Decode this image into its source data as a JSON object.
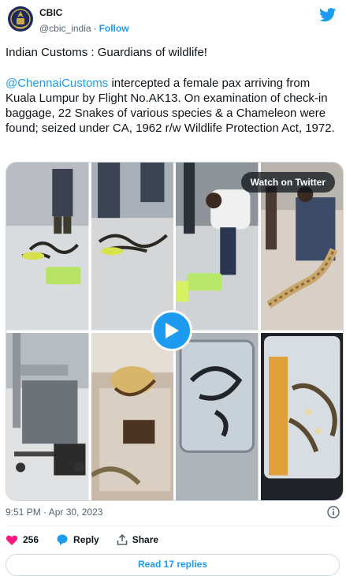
{
  "account": {
    "name": "CBIC",
    "handle": "@cbic_india",
    "separator": "·",
    "follow_label": "Follow"
  },
  "tweet": {
    "line1": "Indian Customs : Guardians of wildlife!",
    "mention": "@ChennaiCustoms",
    "body": " intercepted a female pax arriving from Kuala Lumpur by Flight No.AK13. On examination of check-in baggage, 22 Snakes of various species & a Chameleon were found; seized under CA, 1962 r/w Wildlife Protection Act, 1972."
  },
  "media": {
    "watch_label": "Watch on Twitter",
    "thumbnails": [
      "customs officers with snakes on airport floor",
      "snakes on floor beside green container",
      "officer lifting snake from floor",
      "officer holding large python",
      "luggage trolley with bags",
      "hands holding a snake",
      "snake in plastic box",
      "snakes in taped plastic box"
    ]
  },
  "meta": {
    "timestamp": "9:51 PM · Apr 30, 2023"
  },
  "actions": {
    "likes": "256",
    "reply_label": "Reply",
    "share_label": "Share"
  },
  "read_replies_label": "Read 17 replies",
  "colors": {
    "accent": "#1d9bf0",
    "like": "#f91880",
    "muted": "#536471"
  }
}
